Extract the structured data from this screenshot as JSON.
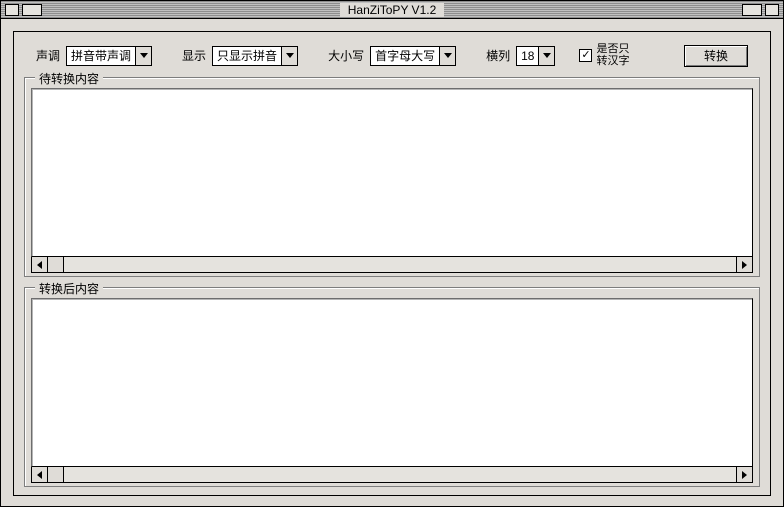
{
  "window": {
    "title": "HanZiToPY  V1.2"
  },
  "options": {
    "tone_label": "声调",
    "tone_value": "拼音带声调",
    "display_label": "显示",
    "display_value": "只显示拼音",
    "case_label": "大小写",
    "case_value": "首字母大写",
    "columns_label": "横列",
    "columns_value": "18",
    "checkbox_label": "是否只\n转汉字",
    "checkbox_checked": "✓",
    "convert_button": "转换"
  },
  "groups": {
    "input_legend": "待转换内容",
    "output_legend": "转换后内容"
  }
}
